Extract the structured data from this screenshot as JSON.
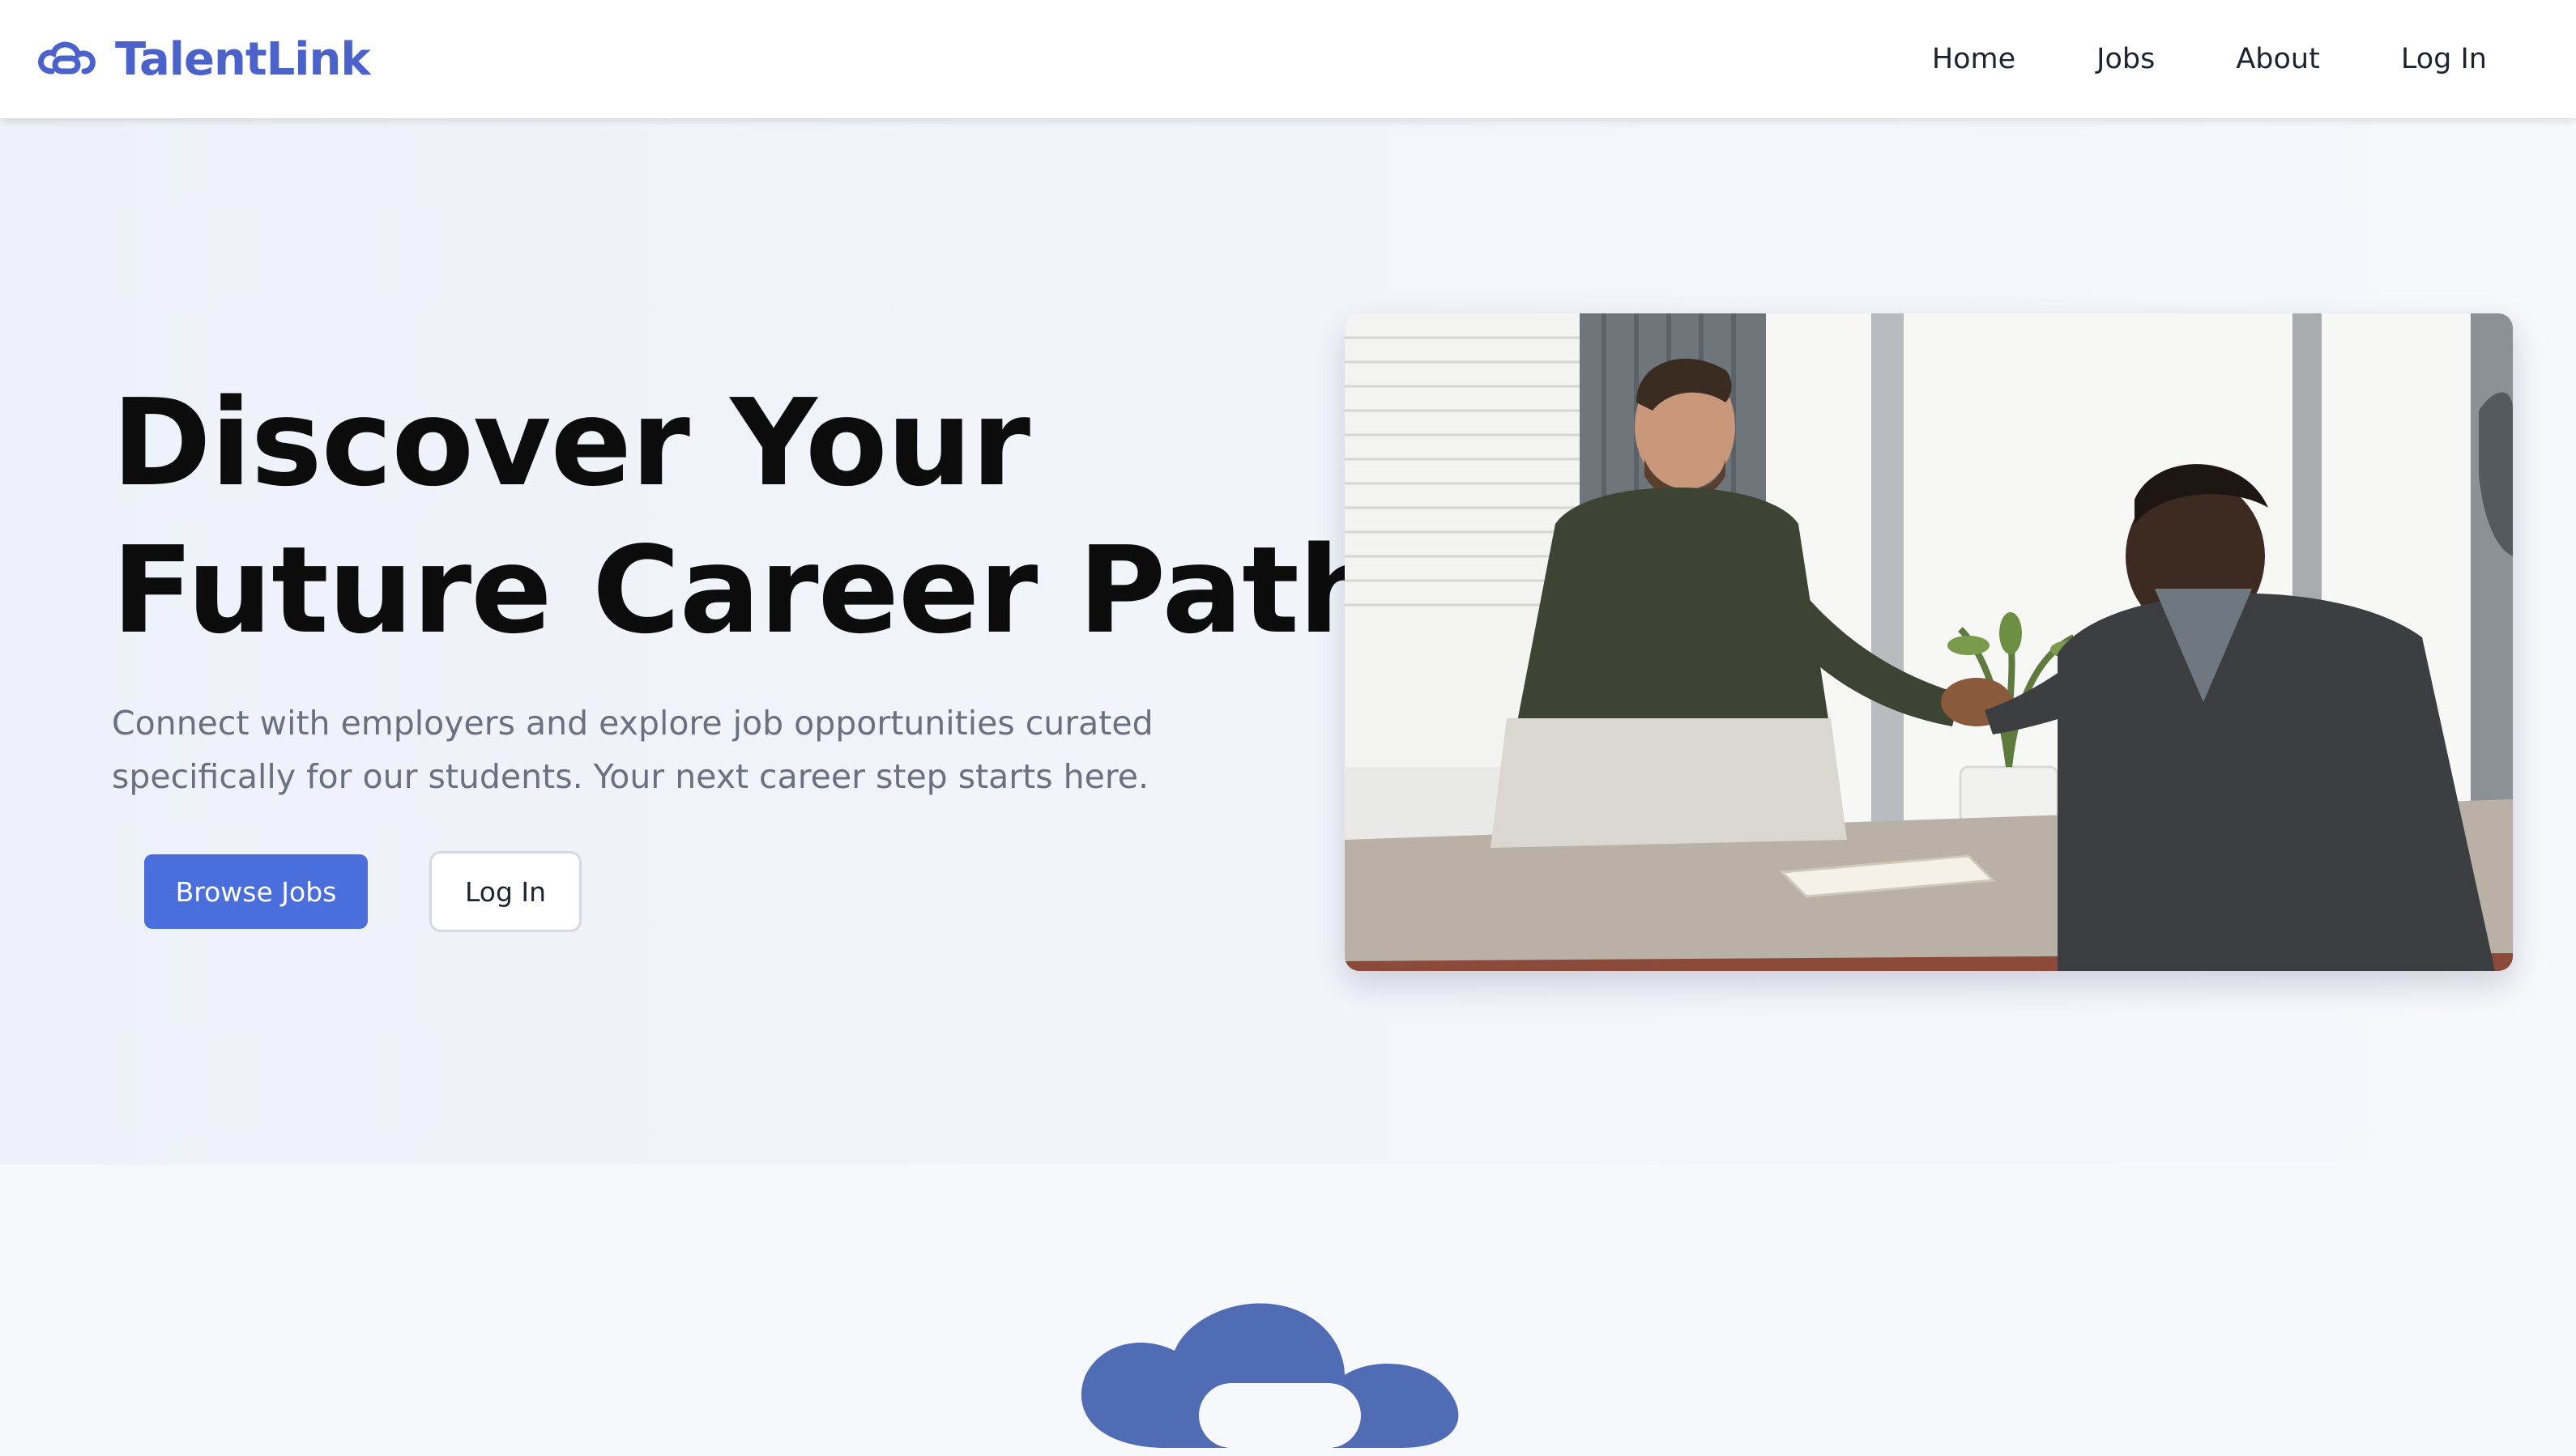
{
  "brand": {
    "name": "TalentLink",
    "logo_icon": "cloud-link-icon",
    "color": "#4a62c9"
  },
  "nav": {
    "links": [
      {
        "label": "Home"
      },
      {
        "label": "Jobs"
      },
      {
        "label": "About"
      },
      {
        "label": "Log In"
      }
    ]
  },
  "hero": {
    "title_line1": "Discover Your",
    "title_line2": "Future Career Path",
    "subtitle": "Connect with employers and explore job opportunities curated specifically for our students. Your next career step starts here.",
    "primary_button": "Browse Jobs",
    "secondary_button": "Log In",
    "image_alt": "Two people shaking hands across a desk in an office",
    "accent_color": "#4a6fdc"
  },
  "lower": {
    "logo_icon": "cloud-link-icon"
  }
}
